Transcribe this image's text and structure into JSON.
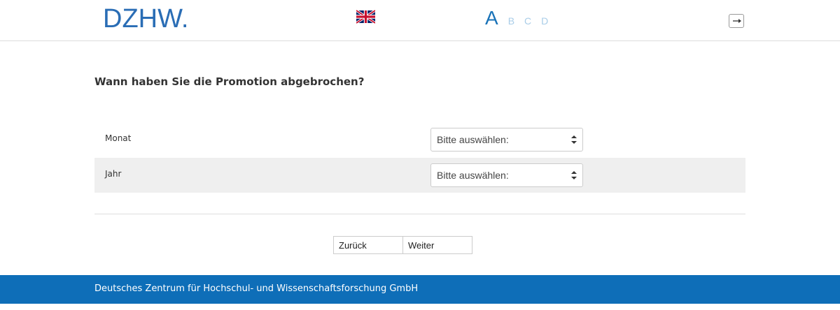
{
  "header": {
    "logo_text": "DZHW",
    "logo_dot": ".",
    "language_flag": "uk-flag-icon",
    "steps": {
      "active": "A",
      "items": [
        "B",
        "C",
        "D"
      ]
    },
    "exit_icon": "exit-icon"
  },
  "question": {
    "text": "Wann haben Sie die Promotion abgebrochen?",
    "rows": [
      {
        "label": "Monat",
        "select_value": "Bitte auswählen:"
      },
      {
        "label": "Jahr",
        "select_value": "Bitte auswählen:"
      }
    ]
  },
  "navigation": {
    "back_label": "Zurück",
    "next_label": "Weiter"
  },
  "footer": {
    "text": "Deutsches Zentrum für Hochschul- und Wissenschaftsforschung GmbH"
  },
  "colors": {
    "brand_blue": "#2a6db5",
    "footer_blue": "#0e6eb8",
    "step_inactive": "#a9cde8"
  }
}
